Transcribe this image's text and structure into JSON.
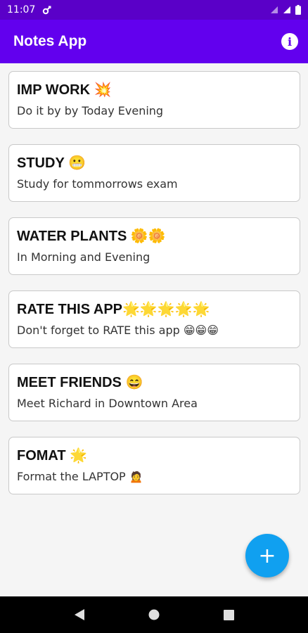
{
  "status_bar": {
    "time": "11:07"
  },
  "app_bar": {
    "title": "Notes App"
  },
  "notes": [
    {
      "title": "IMP WORK 💥",
      "body": "Do it by by Today Evening"
    },
    {
      "title": "STUDY 😬",
      "body": "Study for tommorrows exam"
    },
    {
      "title": "WATER PLANTS 🌼🌼",
      "body": "In Morning and Evening"
    },
    {
      "title": "RATE THIS APP🌟🌟🌟🌟🌟",
      "body": "Don't forget to RATE this app 😁😁😁"
    },
    {
      "title": "MEET FRIENDS 😄",
      "body": "Meet Richard in Downtown Area"
    },
    {
      "title": "FOMAT 🌟",
      "body": "Format the LAPTOP 🙍"
    }
  ],
  "fab": {
    "label": "+"
  },
  "icons": {
    "info": "info-icon",
    "wifi": "wifi-icon",
    "signal": "signal-icon",
    "battery": "battery-icon",
    "add": "add-icon",
    "back": "back-icon",
    "home": "home-icon",
    "recents": "recents-icon"
  },
  "colors": {
    "status_bar": "#5a00c8",
    "app_bar": "#6200ee",
    "fab": "#10a0f0",
    "background": "#f5f5f5"
  }
}
